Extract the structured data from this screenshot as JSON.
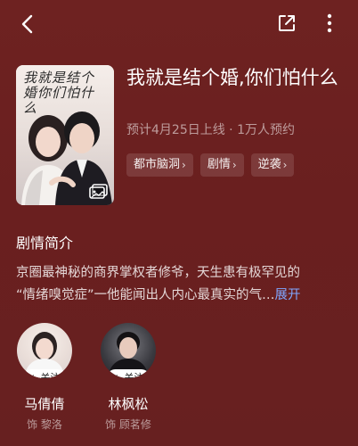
{
  "header": {
    "back_icon": "back-arrow-icon",
    "share_icon": "share-icon",
    "more_icon": "more-vertical-icon"
  },
  "poster": {
    "title_art": "我就是结个婚你们怕什么"
  },
  "show": {
    "title": "我就是结个婚,你们怕什么",
    "subtitle": "预计4月25日上线 · 1万人预约",
    "tags": [
      {
        "label": "都市脑洞"
      },
      {
        "label": "剧情"
      },
      {
        "label": "逆袭"
      }
    ]
  },
  "synopsis": {
    "heading": "剧情简介",
    "line1": "京圈最神秘的商界掌权者修爷，天生患有极罕见的",
    "line2": "“情绪嗅觉症”一他能闻出人内心最真实的气…",
    "expand_label": "展开"
  },
  "cast": [
    {
      "name": "马倩倩",
      "role": "饰 黎洛",
      "follow_label": "+ 关注"
    },
    {
      "name": "林枫松",
      "role": "饰 顾茗修",
      "follow_label": "+ 关注"
    }
  ],
  "colors": {
    "background": "#6b1e1e",
    "link": "#7fa6ff"
  }
}
